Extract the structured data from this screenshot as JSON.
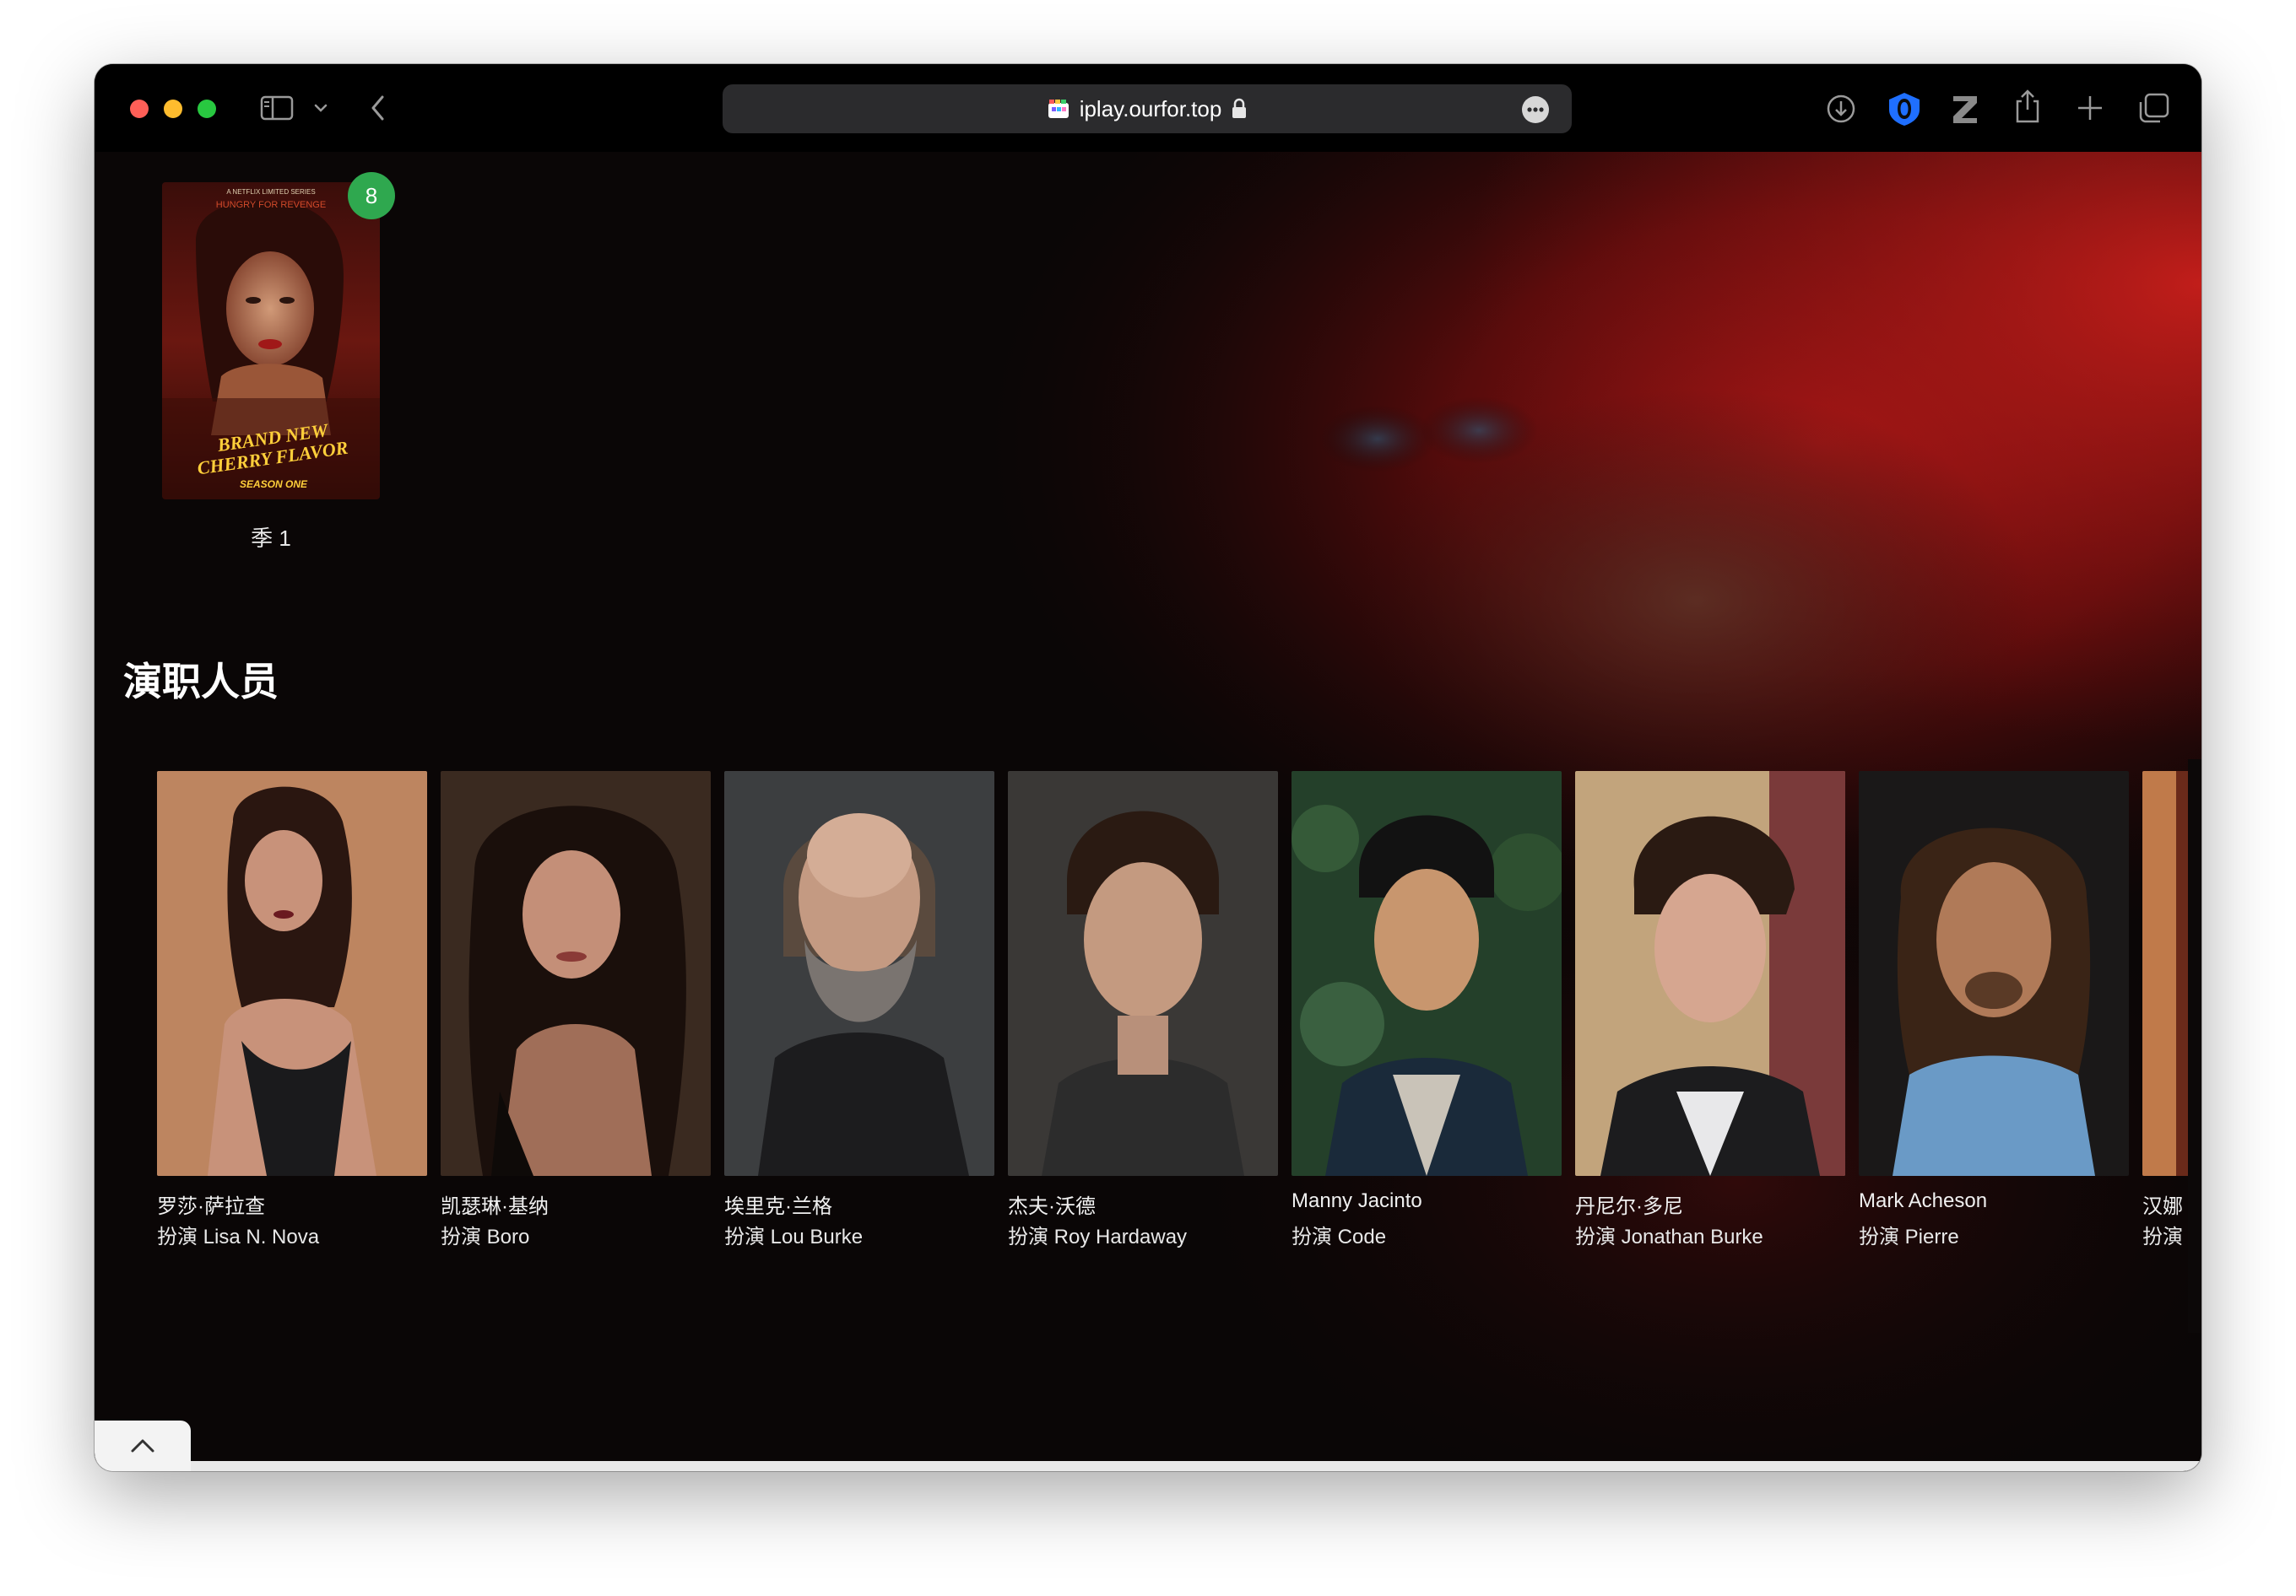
{
  "browser": {
    "url": "iplay.ourfor.top",
    "icons": [
      "sidebar-icon",
      "chevron-down-icon",
      "back-icon",
      "site-favicon",
      "lock-icon",
      "more-icon",
      "downloads-icon",
      "extension-icon",
      "z-extension-icon",
      "share-icon",
      "new-tab-icon",
      "tab-overview-icon"
    ]
  },
  "season": {
    "label": "季 1",
    "unwatched_count": "8",
    "poster_text": {
      "series_line": "A NETFLIX LIMITED SERIES",
      "tagline": "HUNGRY FOR REVENGE",
      "title_line1": "BRAND NEW",
      "title_line2": "CHERRY FLAVOR",
      "subtitle": "SEASON ONE"
    }
  },
  "cast_section": {
    "title": "演职人员",
    "members": [
      {
        "name": "罗莎·萨拉查",
        "role": "扮演 Lisa N. Nova"
      },
      {
        "name": "凯瑟琳·基纳",
        "role": "扮演 Boro"
      },
      {
        "name": "埃里克·兰格",
        "role": "扮演 Lou Burke"
      },
      {
        "name": "杰夫·沃德",
        "role": "扮演 Roy Hardaway"
      },
      {
        "name": "Manny Jacinto",
        "role": "扮演 Code"
      },
      {
        "name": "丹尼尔·多尼",
        "role": "扮演 Jonathan Burke"
      },
      {
        "name": "Mark Acheson",
        "role": "扮演 Pierre"
      },
      {
        "name": "汉娜",
        "role": "扮演"
      }
    ]
  },
  "colors": {
    "badge": "#2fa84f",
    "background": "#0a0606",
    "accent_red": "#c01a1a"
  }
}
